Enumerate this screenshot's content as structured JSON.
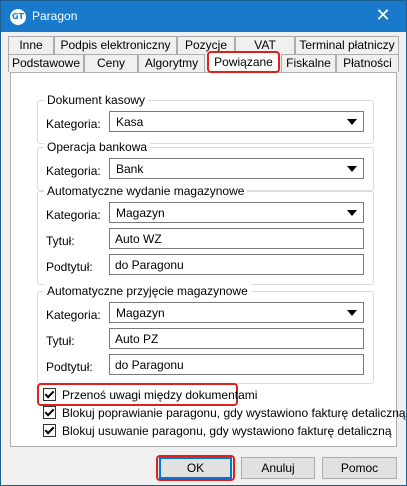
{
  "window": {
    "title": "Paragon",
    "app_icon_text": "GT",
    "close_glyph": "✕"
  },
  "tabs_row1": [
    {
      "label": "Inne"
    },
    {
      "label": "Podpis elektroniczny"
    },
    {
      "label": "Pozycje"
    },
    {
      "label": "VAT"
    },
    {
      "label": "Terminal płatniczy"
    }
  ],
  "tabs_row2": [
    {
      "label": "Podstawowe"
    },
    {
      "label": "Ceny"
    },
    {
      "label": "Algorytmy"
    },
    {
      "label": "Powiązane",
      "active": true
    },
    {
      "label": "Fiskalne"
    },
    {
      "label": "Płatności"
    }
  ],
  "groups": {
    "dokument_kasowy": {
      "legend": "Dokument kasowy",
      "kategoria_label": "Kategoria:",
      "kategoria_value": "Kasa"
    },
    "operacja_bankowa": {
      "legend": "Operacja bankowa",
      "kategoria_label": "Kategoria:",
      "kategoria_value": "Bank"
    },
    "wydanie": {
      "legend": "Automatyczne wydanie magazynowe",
      "kategoria_label": "Kategoria:",
      "kategoria_value": "Magazyn",
      "tytul_label": "Tytuł:",
      "tytul_value": "Auto WZ",
      "podtytul_label": "Podtytuł:",
      "podtytul_value": "do Paragonu"
    },
    "przyjecie": {
      "legend": "Automatyczne przyjęcie magazynowe",
      "kategoria_label": "Kategoria:",
      "kategoria_value": "Magazyn",
      "tytul_label": "Tytuł:",
      "tytul_value": "Auto PZ",
      "podtytul_label": "Podtytuł:",
      "podtytul_value": "do Paragonu"
    }
  },
  "checkboxes": [
    {
      "label": "Przenoś uwagi między dokumentami",
      "checked": true
    },
    {
      "label": "Blokuj poprawianie paragonu, gdy wystawiono fakturę detaliczną",
      "checked": true
    },
    {
      "label": "Blokuj usuwanie paragonu, gdy wystawiono fakturę detaliczną",
      "checked": true
    }
  ],
  "buttons": {
    "ok": "OK",
    "anuluj": "Anuluj",
    "pomoc": "Pomoc"
  },
  "colors": {
    "titlebar": "#1979ca",
    "highlight": "#e0211a",
    "default_button_border": "#0078d7"
  }
}
